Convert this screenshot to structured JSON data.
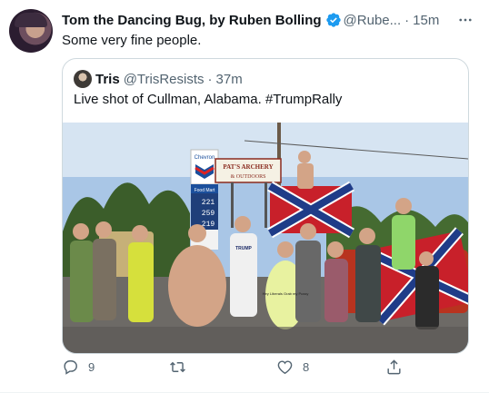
{
  "tweet": {
    "author_name": "Tom the Dancing Bug, by Ruben Bolling",
    "handle": "@Rube...",
    "separator": "·",
    "time": "15m",
    "text": "Some very fine people.",
    "more_icon": "more-horizontal-icon",
    "verified_icon": "verified-badge-icon"
  },
  "quote": {
    "author_name": "Tris",
    "handle": "@TrisResists",
    "separator": "·",
    "time": "37m",
    "text": "Live shot of Cullman, Alabama. #TrumpRally",
    "image": {
      "signs": {
        "chevron": "Chevron",
        "archery_line1": "PAT'S ARCHERY",
        "archery_line2": "& OUTDOORS",
        "food_mart": "Food Mart",
        "price1": "221",
        "price2": "259",
        "price3": "219",
        "shirt_slogan": "Hey Liberals Grab my Pussy",
        "trump_shirt": "TRUMP"
      }
    }
  },
  "actions": {
    "reply": {
      "icon": "reply-icon",
      "count": "9"
    },
    "retweet": {
      "icon": "retweet-icon",
      "count": ""
    },
    "like": {
      "icon": "heart-icon",
      "count": "8"
    },
    "share": {
      "icon": "share-icon",
      "count": ""
    }
  },
  "colors": {
    "text_primary": "#0f1419",
    "text_secondary": "#536471",
    "verified_blue": "#1d9bf0",
    "border": "#cfd9de"
  }
}
